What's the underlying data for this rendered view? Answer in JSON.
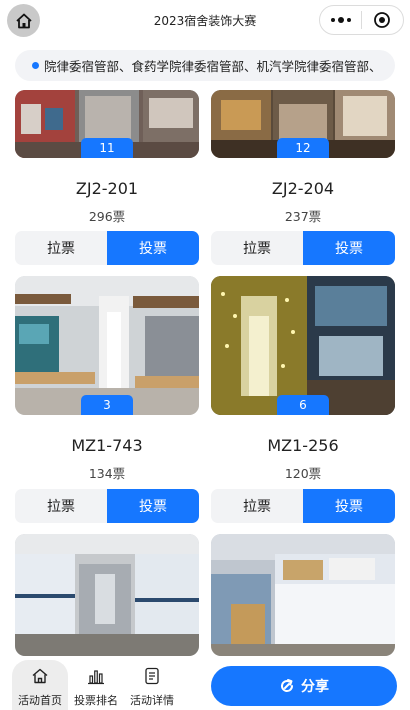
{
  "header": {
    "title": "2023宿舍装饰大赛",
    "home_icon": "home-icon",
    "more_icon": "more-dots-icon",
    "close_icon": "record-target-icon"
  },
  "notice": {
    "text": "院律委宿管部、食药学院律委宿管部、机汽学院律委宿管部、",
    "icon": "notice-dot-icon",
    "accent": "#1677ff"
  },
  "cards": [
    {
      "number": "11",
      "room": "ZJ2-201",
      "votes": "296票",
      "pull_label": "拉票",
      "vote_label": "投票"
    },
    {
      "number": "12",
      "room": "ZJ2-204",
      "votes": "237票",
      "pull_label": "拉票",
      "vote_label": "投票"
    },
    {
      "number": "3",
      "room": "MZ1-743",
      "votes": "134票",
      "pull_label": "拉票",
      "vote_label": "投票"
    },
    {
      "number": "6",
      "room": "MZ1-256",
      "votes": "120票",
      "pull_label": "拉票",
      "vote_label": "投票"
    },
    {
      "number": "",
      "room": "",
      "votes": "",
      "pull_label": "",
      "vote_label": ""
    },
    {
      "number": "",
      "room": "",
      "votes": "",
      "pull_label": "",
      "vote_label": ""
    }
  ],
  "bottom_nav": {
    "tabs": [
      {
        "label": "活动首页",
        "icon": "home-outline-icon",
        "active": true
      },
      {
        "label": "投票排名",
        "icon": "bar-chart-icon",
        "active": false
      },
      {
        "label": "活动详情",
        "icon": "document-icon",
        "active": false
      }
    ],
    "share_label": "分享",
    "share_icon": "share-refresh-icon"
  },
  "colors": {
    "primary": "#1677ff",
    "button_gray": "#f2f3f5",
    "notice_bg": "#f2f3f6"
  }
}
